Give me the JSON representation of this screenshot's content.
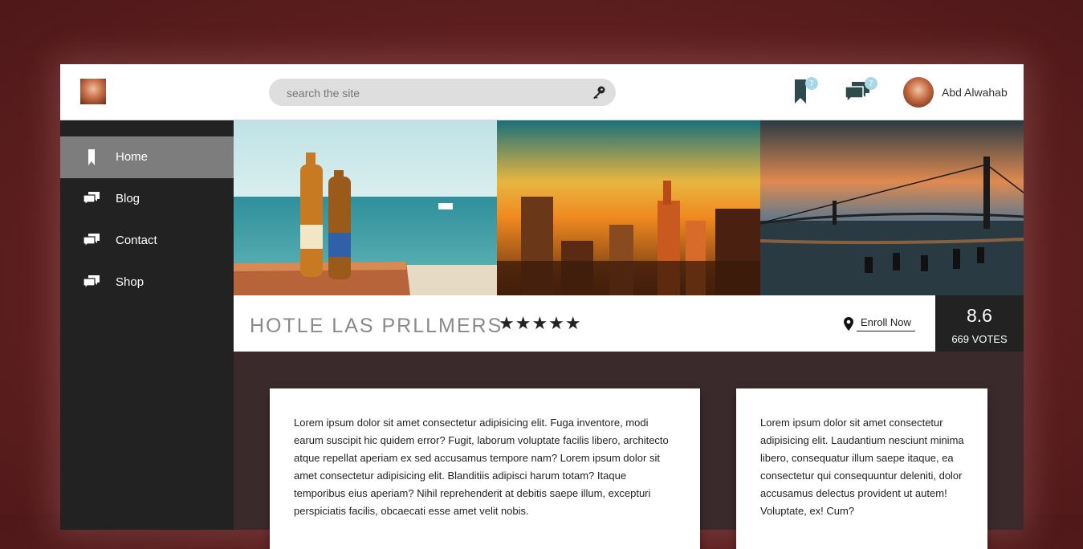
{
  "header": {
    "search_placeholder": "search the site",
    "bookmark_badge": "7",
    "messages_badge": "7",
    "user_name": "Abd Alwahab"
  },
  "sidebar": {
    "items": [
      {
        "label": "Home",
        "icon": "bookmark-icon",
        "active": true
      },
      {
        "label": "Blog",
        "icon": "chat-icon"
      },
      {
        "label": "Contact",
        "icon": "chat-icon"
      },
      {
        "label": "Shop",
        "icon": "chat-icon"
      }
    ]
  },
  "gallery": {
    "photos": [
      "beach-beer-photo",
      "city-sunset-photo",
      "bridge-sunset-photo"
    ]
  },
  "hotel": {
    "name": "HOTLE LAS PRLLMERS",
    "stars": "★★★★★",
    "enroll_label": "Enroll Now",
    "score": "8.6",
    "votes": "669 VOTES"
  },
  "cards": [
    {
      "text": "Lorem ipsum dolor sit amet consectetur adipisicing elit. Fuga inventore, modi earum suscipit hic quidem error? Fugit, laborum voluptate facilis libero, architecto atque repellat aperiam ex sed accusamus tempore nam? Lorem ipsum dolor sit amet consectetur adipisicing elit. Blanditiis adipisci harum totam? Itaque temporibus eius aperiam? Nihil reprehenderit at debitis saepe illum, excepturi perspiciatis facilis, obcaecati esse amet velit nobis."
    },
    {
      "text": "Lorem ipsum dolor sit amet consectetur adipisicing elit. Laudantium nesciunt minima libero, consequatur illum saepe itaque, ea consectetur qui consequuntur deleniti, dolor accusamus delectus provident ut autem! Voluptate, ex! Cum?"
    }
  ],
  "colors": {
    "background": "#5e1f20",
    "sidebar": "#222222",
    "active_nav": "#7d7d7d",
    "badge": "#a8d8e8",
    "icon_teal": "#2e4a4c"
  }
}
